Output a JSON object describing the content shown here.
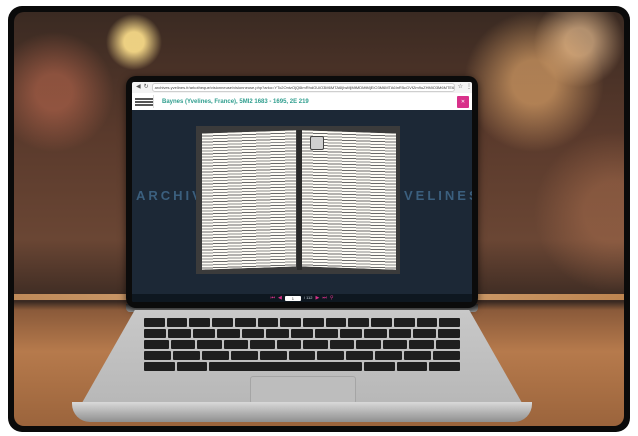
{
  "browser": {
    "url": "archives.yvelines.fr/arkotheque/visionneuse/visionneuse.php?arko=YTo2OntzOjQ6ImRhdGUiO3M6MTA6IjIwMjMtMDMtMjEiO3M6MTA6InR5cGVfZm9uZHMiO3M6MTE6ImFya29fc2VyaWVsIjtzOjQ6InJlZjEiO2k6NDtzOjQ6InJlZjIiO2k6MjAyMTY0Ozs=",
    "back_icon": "left-arrow-icon",
    "reload_icon": "reload-icon"
  },
  "viewer": {
    "title": "Baynes (Yvelines, France), 5MI2 1683 - 1695, 2E 219",
    "close_icon": "close-icon",
    "watermark_left": "ARCHIV",
    "watermark_right": "VELINES",
    "pager": {
      "current": "1",
      "total": "/ 112"
    }
  },
  "colors": {
    "accent": "#d8318a",
    "title": "#2f9e8e",
    "viewer_bg": "#1c2836"
  }
}
